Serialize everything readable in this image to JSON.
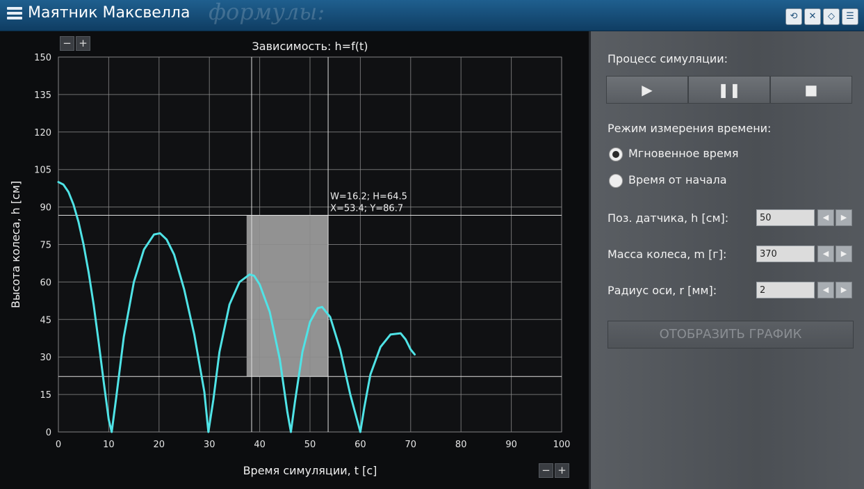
{
  "app": {
    "title": "Маятник Максвелла",
    "background_word": "формулы:"
  },
  "top_buttons": [
    {
      "icon": "refresh-icon",
      "glyph": "⟲"
    },
    {
      "icon": "mute-icon",
      "glyph": "✕"
    },
    {
      "icon": "eraser-icon",
      "glyph": "◇"
    },
    {
      "icon": "list-icon",
      "glyph": "☰"
    }
  ],
  "graph": {
    "zoom_minus": "−",
    "zoom_plus": "+",
    "selection_label_1": "W=16.2; H=64.5",
    "selection_label_2": "X=53.4; Y=86.7",
    "selection": {
      "x": [
        37.4,
        53.6
      ],
      "y": [
        22.2,
        86.7
      ]
    },
    "colors": {
      "curve": "#4fe3e6",
      "grid": "#8a8a8a",
      "selection": "#bdbdbd"
    }
  },
  "chart_data": {
    "type": "line",
    "title": "Зависимость: h=f(t)",
    "xlabel": "Время симуляции, t [с]",
    "ylabel": "Высота колеса, h [см]",
    "xlim": [
      0,
      100
    ],
    "ylim": [
      0,
      150
    ],
    "xticks": [
      0,
      10,
      20,
      30,
      40,
      50,
      60,
      70,
      80,
      90,
      100
    ],
    "yticks": [
      0,
      15,
      30,
      45,
      60,
      75,
      90,
      105,
      120,
      135,
      150
    ],
    "grid": true,
    "series": [
      {
        "x": [
          0,
          1,
          2,
          3,
          4,
          5,
          6,
          7,
          8,
          9,
          10,
          10.6,
          11.5,
          13,
          15,
          17,
          19,
          20.2,
          21.5,
          23,
          25,
          27,
          29,
          29.8,
          30.8,
          32,
          34,
          36,
          38,
          38.9,
          40,
          42,
          44,
          45.5,
          46.2,
          47,
          48.5,
          50,
          51.5,
          52.4,
          54,
          56,
          58,
          60,
          60.8,
          62,
          64,
          66,
          68,
          69,
          70,
          70.8
        ],
        "y": [
          100,
          99,
          96,
          91,
          84,
          75,
          64,
          51,
          36,
          20,
          5,
          0,
          14,
          38,
          60,
          73,
          79,
          79.5,
          77,
          71,
          57,
          39,
          16,
          0,
          13,
          32,
          51,
          60,
          63,
          62.5,
          59,
          48,
          29,
          8,
          0,
          12,
          32,
          44,
          49.5,
          50,
          46,
          33,
          15,
          0,
          10,
          23,
          34,
          39,
          39.5,
          37,
          33,
          31
        ]
      }
    ]
  },
  "controls": {
    "simulation_label": "Процесс симуляции:",
    "play": "▶",
    "pause": "❚❚",
    "stop": "■",
    "time_mode_label": "Режим измерения времени:",
    "radio_instant": "Мгновенное время",
    "radio_from_start": "Время от начала",
    "sensor_label": "Поз. датчика, h [см]:",
    "sensor_value": "50",
    "mass_label": "Масса колеса, m [г]:",
    "mass_value": "370",
    "radius_label": "Радиус оси, r [мм]:",
    "radius_value": "2",
    "step_left": "◀",
    "step_right": "▶",
    "show_graph": "ОТОБРАЗИТЬ ГРАФИК"
  }
}
